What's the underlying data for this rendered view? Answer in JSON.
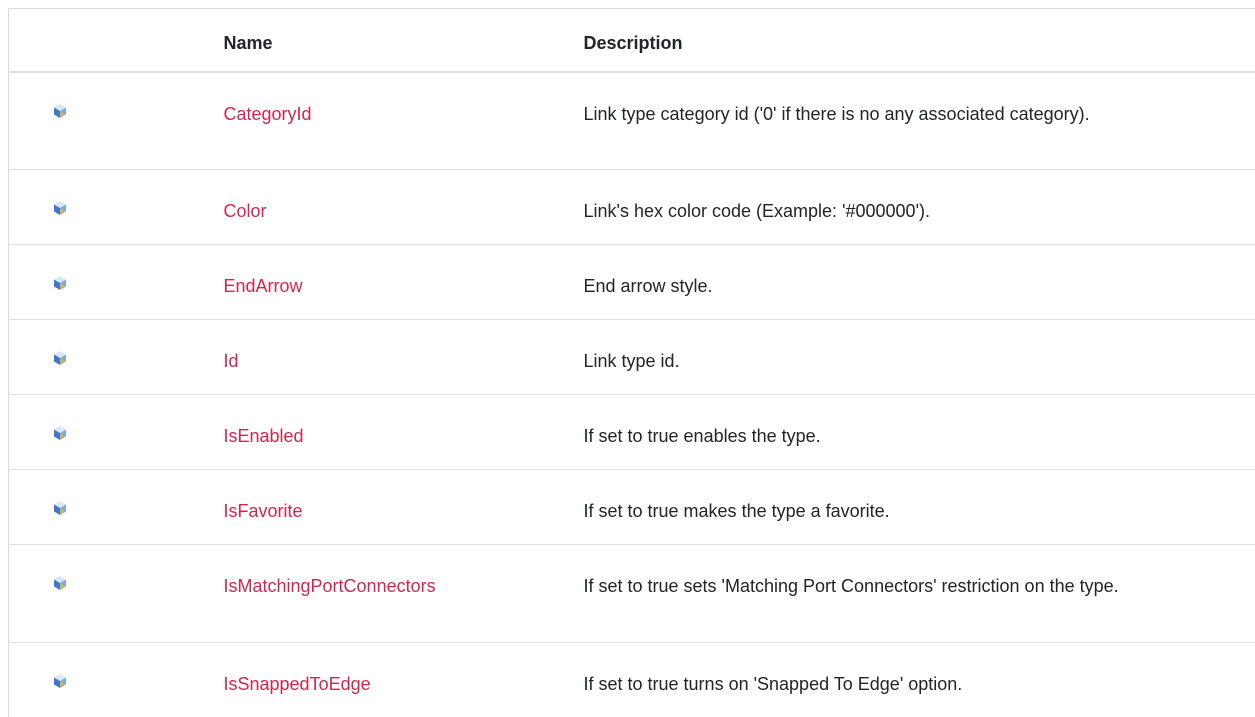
{
  "header": {
    "name_label": "Name",
    "description_label": "Description"
  },
  "rows": [
    {
      "icon": "property-icon",
      "name": "CategoryId",
      "description": "Link type category id ('0' if there is no any associated category)."
    },
    {
      "icon": "property-icon",
      "name": "Color",
      "description": "Link's hex color code (Example: '#000000')."
    },
    {
      "icon": "property-icon",
      "name": "EndArrow",
      "description": "End arrow style."
    },
    {
      "icon": "property-icon",
      "name": "Id",
      "description": "Link type id."
    },
    {
      "icon": "property-icon",
      "name": "IsEnabled",
      "description": "If set to true enables the type."
    },
    {
      "icon": "property-icon",
      "name": "IsFavorite",
      "description": "If set to true makes the type a favorite."
    },
    {
      "icon": "property-icon",
      "name": "IsMatchingPortConnectors",
      "description": "If set to true sets 'Matching Port Connectors' restriction on the type."
    },
    {
      "icon": "property-icon",
      "name": "IsSnappedToEdge",
      "description": "If set to true turns on 'Snapped To Edge' option."
    }
  ],
  "colors": {
    "link": "#d3254e",
    "text": "#212529",
    "border": "#dee2e6"
  }
}
